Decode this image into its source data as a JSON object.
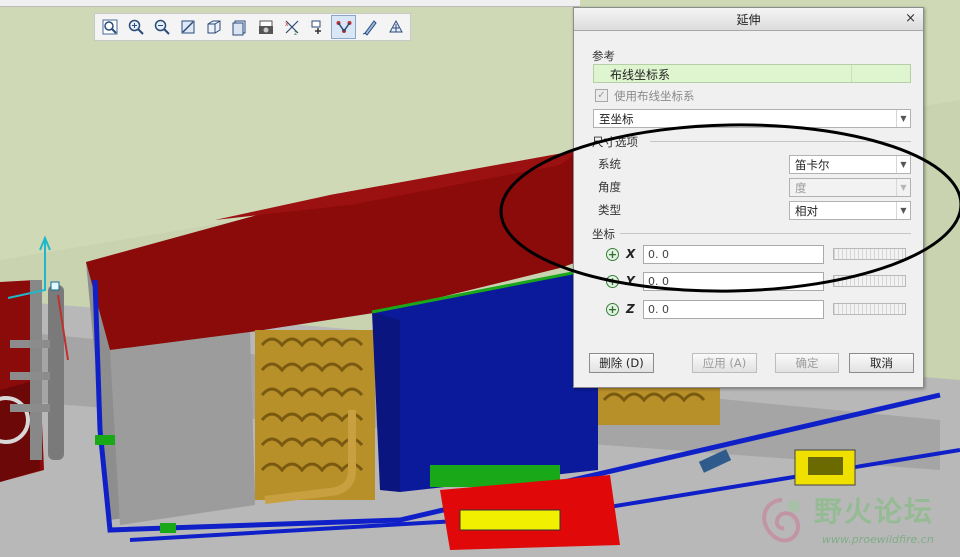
{
  "dialog": {
    "title": "延伸",
    "close_glyph": "×",
    "reference_label": "参考",
    "reference_value": "布线坐标系",
    "use_coord_checkbox_label": "使用布线坐标系",
    "use_coord_checked": true,
    "mode_select": "至坐标",
    "size_options_title": "尺寸选项",
    "system_label": "系统",
    "system_value": "笛卡尔",
    "angle_label": "角度",
    "angle_value": "度",
    "type_label": "类型",
    "type_value": "相对",
    "coord_title": "坐标",
    "coords": [
      {
        "axis": "X",
        "value": "0. 0"
      },
      {
        "axis": "Y",
        "value": "0. 0"
      },
      {
        "axis": "Z",
        "value": "0. 0"
      }
    ],
    "buttons": {
      "delete": "删除 (D)",
      "apply": "应用 (A)",
      "ok": "确定",
      "cancel": "取消"
    }
  },
  "toolbar": {
    "icons": [
      "zoom-fit-icon",
      "zoom-in-icon",
      "zoom-out-icon",
      "refit-view-icon",
      "shaded-view-icon",
      "saved-views-icon",
      "camera-icon",
      "datum-display-icon",
      "spin-center-icon",
      "route-cable-icon",
      "sketch-icon",
      "orient-icon"
    ]
  },
  "watermark": {
    "text": "野火论坛",
    "url": "www.proewildfire.cn"
  },
  "colors": {
    "roof_red": "#8b0a0a",
    "panel_blue": "#0b1a9a",
    "coil_gold": "#b8902a",
    "background_green": "#c9d3b0",
    "frame_grey": "#9a9a9a",
    "accent_green": "#1aa81a",
    "annotation_black": "#000000"
  }
}
